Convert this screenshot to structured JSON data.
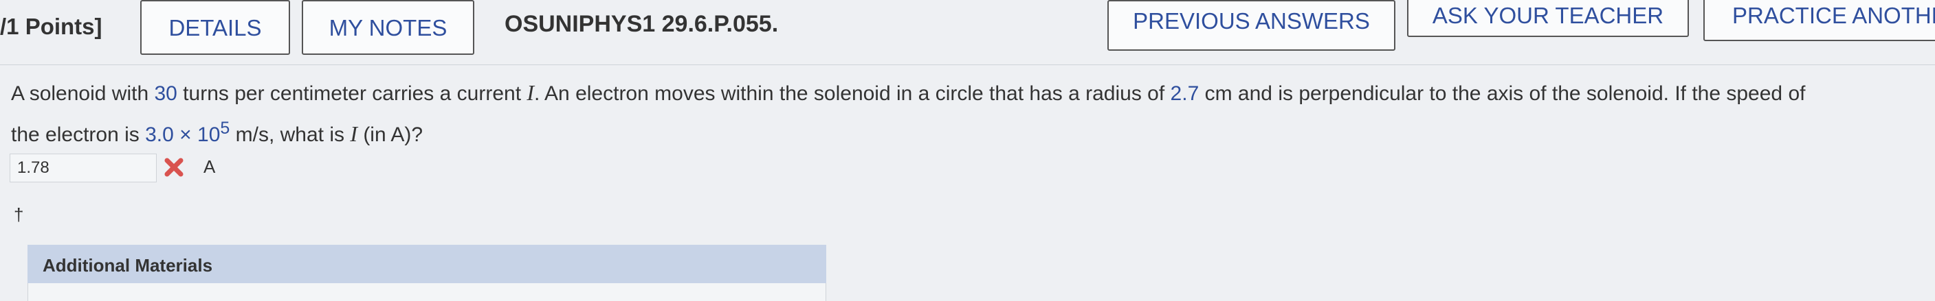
{
  "header": {
    "points": "/1 Points]",
    "details_label": "DETAILS",
    "notes_label": "MY NOTES",
    "question_id": "OSUNIPHYS1 29.6.P.055.",
    "previous_answers_label": "PREVIOUS ANSWERS",
    "ask_teacher_label": "ASK YOUR TEACHER",
    "practice_label": "PRACTICE ANOTHE"
  },
  "question": {
    "p1": "A solenoid with ",
    "turns": "30",
    "p2": " turns per centimeter carries a current ",
    "var_i": "I",
    "p3": ". An electron moves within the solenoid in a circle that has a radius of ",
    "radius": "2.7",
    "p4": " cm and is perpendicular to the axis of the solenoid. If the speed of",
    "p5": "the electron is ",
    "speed_mantissa": "3.0 × 10",
    "speed_exp": "5",
    "p6": " m/s, what is ",
    "var_i2": "I",
    "p7": " (in A)?"
  },
  "answer": {
    "value": "1.78",
    "unit": "A",
    "status_icon": "wrong-x-icon",
    "footnote": "†"
  },
  "additional": {
    "label": "Additional Materials"
  },
  "colors": {
    "accent": "#2f4f9e",
    "wrong": "#d9534f",
    "panel": "#c7d3e7"
  }
}
